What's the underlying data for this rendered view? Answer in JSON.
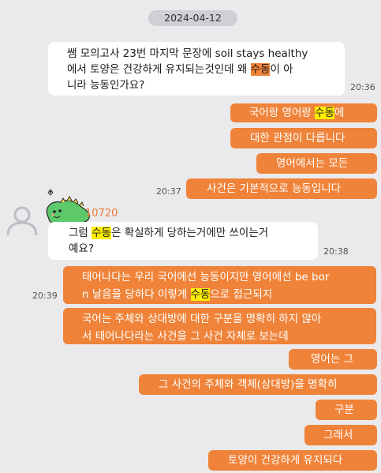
{
  "date": "2024-04-12",
  "msg1": {
    "line1": "쌤 모의고사 23번 마지막 문장에 soil stays healthy",
    "line2_a": "에서 토양은 건강하게 유지되는것인데 왜 ",
    "line2_hl": "수동",
    "line2_b": "이 아",
    "line3": "니라 능동인가요?",
    "time": "20:36"
  },
  "out1": {
    "a": "국어랑 영어랑 ",
    "hl": "수동",
    "b": "에"
  },
  "out2": "대한 관점이 다릅니다",
  "out3": "영어에서는 모든",
  "out4": "사건은 기본적으로 능동입니다",
  "out4_time": "20:37",
  "sender": {
    "nickname": "10720"
  },
  "msg2": {
    "line1_a": "그럼 ",
    "line1_hl": "수동",
    "line1_b": "은 확실하게 당하는거에만 쓰이는거",
    "line2": "예요?",
    "time": "20:38"
  },
  "out5": {
    "line1": "태어나다는 우리 국어에선 능동이지만 영어에선 be bor",
    "line2_a": "n 날음을 당하다 이렇게 ",
    "line2_hl": "수동",
    "line2_b": "으로 접근되지",
    "time": "20:39"
  },
  "out6": {
    "line1": "국어는 주체와 상대방에 대한 구분을 명확히 하지 않아",
    "line2": "서 태어나다라는 사건을 그 사건 자체로 보는데"
  },
  "out7": "영어는 그",
  "out8": "그 사건의 주체와 객체(상대방)을 명확히",
  "out9": "구분",
  "out10": "그래서",
  "out11": "토양이 건강하게 유지되다"
}
